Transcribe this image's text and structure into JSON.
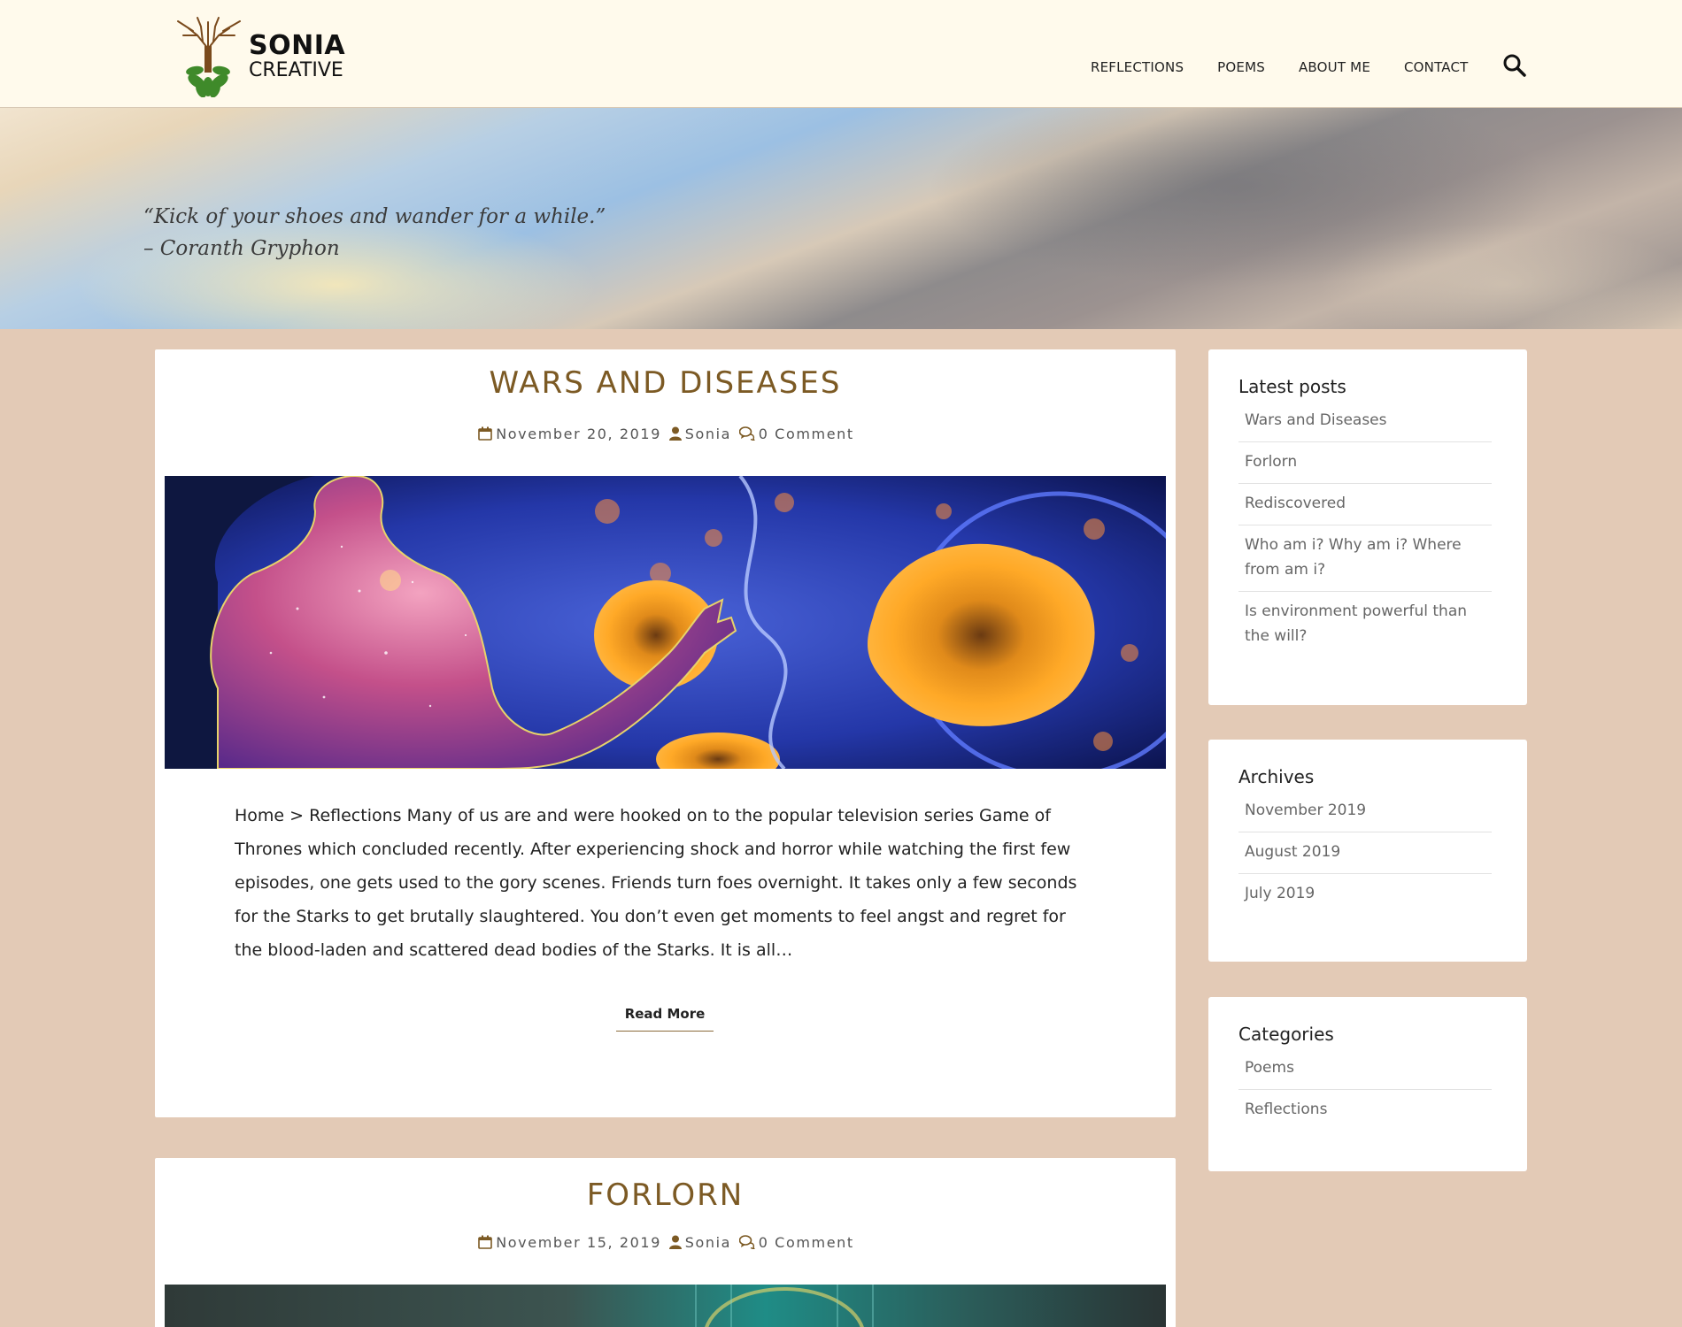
{
  "site": {
    "logo_line1": "SONIA",
    "logo_line2": "CREATIVE"
  },
  "nav": {
    "items": [
      "REFLECTIONS",
      "POEMS",
      "ABOUT ME",
      "CONTACT"
    ],
    "search_icon": "search-icon"
  },
  "banner": {
    "quote": "“Kick of your shoes and wander for a while.”",
    "author": "– Coranth Gryphon"
  },
  "posts": [
    {
      "title": "WARS AND DISEASES",
      "date": "November 20, 2019",
      "author": "Sonia",
      "comments": "0 Comment",
      "excerpt": "Home > Reflections Many of us are and were hooked on to the popular television series Game of Thrones which concluded recently. After experiencing shock and horror while watching the first few episodes, one gets used to the gory scenes. Friends turn foes overnight. It takes only a few seconds for the Starks to get brutally slaughtered. You don’t even get moments to feel angst and regret for the blood-laden and scattered dead bodies of the Starks. It is all…",
      "read_more": "Read More"
    },
    {
      "title": "FORLORN",
      "date": "November 15, 2019",
      "author": "Sonia",
      "comments": "0 Comment"
    }
  ],
  "sidebar": {
    "latest": {
      "title": "Latest posts",
      "items": [
        "Wars and Diseases",
        "Forlorn",
        "Rediscovered",
        "Who am i? Why am i? Where from am i?",
        "Is environment powerful than the will?"
      ]
    },
    "archives": {
      "title": "Archives",
      "items": [
        "November 2019",
        "August 2019",
        "July 2019"
      ]
    },
    "categories": {
      "title": "Categories",
      "items": [
        "Poems",
        "Reflections"
      ]
    }
  },
  "colors": {
    "page_bg": "#e3cab6",
    "header_bg": "#fffaec",
    "title_brown": "#7c5a24"
  }
}
